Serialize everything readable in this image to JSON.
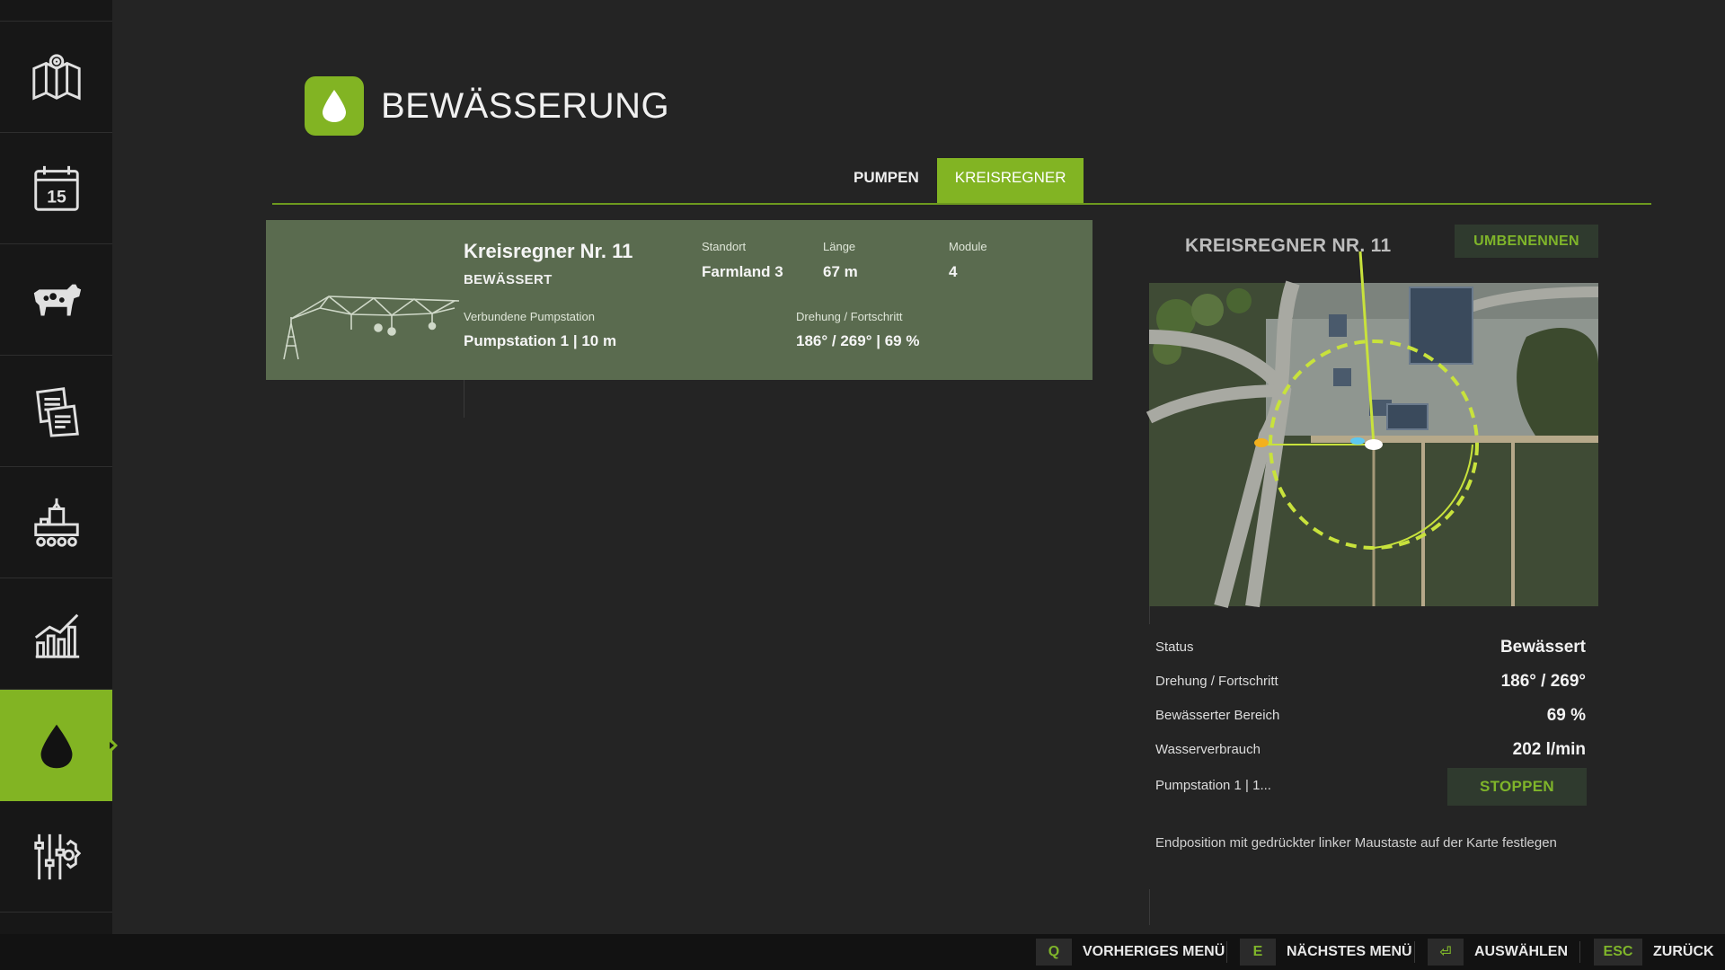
{
  "page": {
    "title": "BEWÄSSERUNG",
    "icon": "water-drop-icon"
  },
  "sidebar": {
    "items": [
      {
        "icon": "map-icon",
        "active": false
      },
      {
        "icon": "calendar-icon",
        "active": false,
        "day": "15"
      },
      {
        "icon": "cow-icon",
        "active": false
      },
      {
        "icon": "contracts-icon",
        "active": false
      },
      {
        "icon": "production-icon",
        "active": false
      },
      {
        "icon": "statistics-icon",
        "active": false
      },
      {
        "icon": "water-drop-icon",
        "active": true
      },
      {
        "icon": "settings-icon",
        "active": false
      }
    ]
  },
  "tabs": [
    {
      "label": "PUMPEN",
      "active": false
    },
    {
      "label": "KREISREGNER",
      "active": true
    }
  ],
  "list": {
    "items": [
      {
        "name": "Kreisregner Nr. 11",
        "status": "BEWÄSSERT",
        "location_label": "Standort",
        "location": "Farmland 3",
        "length_label": "Länge",
        "length": "67 m",
        "modules_label": "Module",
        "modules": "4",
        "pump_label": "Verbundene Pumpstation",
        "pump": "Pumpstation 1  |  10 m",
        "rotation_label": "Drehung / Fortschritt",
        "rotation": "186° / 269°   |   69 %"
      }
    ]
  },
  "detail": {
    "title": "KREISREGNER NR. 11",
    "rename_label": "UMBENENNEN",
    "rows": [
      {
        "label": "Status",
        "value": "Bewässert"
      },
      {
        "label": "Drehung / Fortschritt",
        "value": "186° / 269°"
      },
      {
        "label": "Bewässerter Bereich",
        "value": "69 %"
      },
      {
        "label": "Wasserverbrauch",
        "value": "202 l/min"
      }
    ],
    "pump_text": "Pumpstation 1  |  1...",
    "stop_label": "STOPPEN",
    "hint": "Endposition mit gedrückter linker Maustaste auf der Karte festlegen"
  },
  "footer": {
    "keys": [
      {
        "key": "Q",
        "label": "VORHERIGES MENÜ"
      },
      {
        "key": "E",
        "label": "NÄCHSTES MENÜ"
      },
      {
        "key": "⏎",
        "label": "AUSWÄHLEN"
      },
      {
        "key": "ESC",
        "label": "ZURÜCK"
      }
    ]
  },
  "colors": {
    "accent": "#82b423",
    "card": "#5a6b4f",
    "background": "#242424",
    "sidebar": "#171717"
  }
}
